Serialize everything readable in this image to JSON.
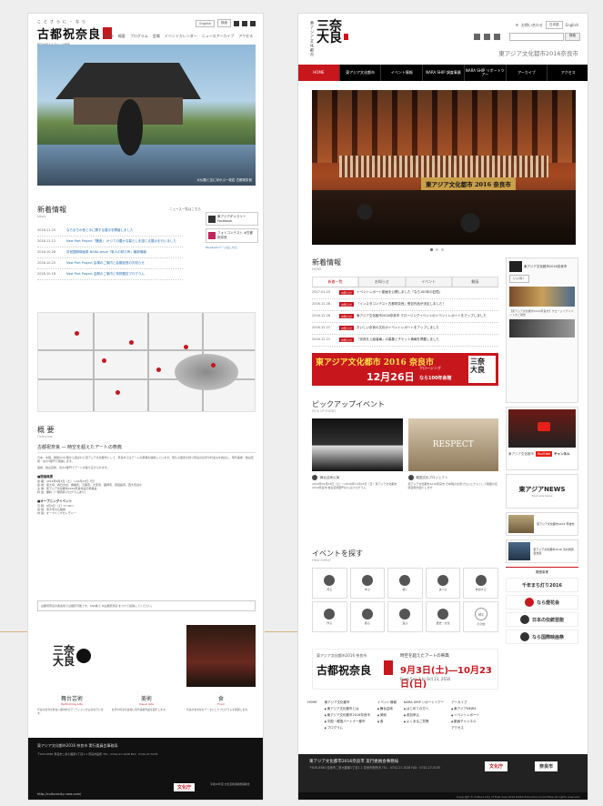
{
  "left_page": {
    "logo": {
      "top": "ことさらに・なら",
      "main": "古都祝奈良",
      "sub": "時空を超えたアートの祭典"
    },
    "util": {
      "btn1": "English",
      "btn2": "検索"
    },
    "nav": [
      "Home",
      "概要",
      "プログラム",
      "会場",
      "イベントカレンダー",
      "ニュースアーカイブ",
      "アクセス"
    ],
    "hero_caption": "大仏殿と空に浮かぶ一枚岩 古都祝奈良",
    "news": {
      "title": "新着情報",
      "sub": "News",
      "more": "ニュース一覧はこちら",
      "items": [
        {
          "date": "2016.11.20",
          "text": "ならまちの昔と今に関する展示を開催しました"
        },
        {
          "date": "2016.11.12",
          "text": "New Port Project「醸造」 かつての豊かな暮らしを感じる展示を行いました"
        },
        {
          "date": "2016.10.28",
          "text": "奈良国際映画祭 NARA-wave「新人の呼び声」最新情報"
        },
        {
          "date": "2016.10.25",
          "text": "New Port Project 会場のご案内と会期延長のお知らせ"
        },
        {
          "date": "2016.10.18",
          "text": "New Port Project 会期のご案内と特別鑑賞プログラム"
        }
      ]
    },
    "side": {
      "fb": "東アジアギャラリー Facebook",
      "ig": "フォトコンテスト #古都祝奈良",
      "link": "Facebookページはこちら"
    },
    "overview": {
      "title": "概 要",
      "sub": "Overview",
      "heading": "古都祝奈良 ― 時空を超えたアートの祭典",
      "para": "日本、中国、韓国の3か国から選ばれた東アジア文化都市として、奈良市ではアートの祭典を開催しています。悠久の歴史を持つ奈良の社寺や町並みを舞台に、現代美術・舞台芸術・食の3部門で展開します。",
      "para2": "美術、舞台芸術、食の3部門でアートが繰り広げられます。",
      "info_head": "■開催概要",
      "info": [
        "会 期：2016年9月3日（土）～10月23日（日）",
        "会 場：東大寺、春日大社、興福寺、元興寺、大安寺、薬師寺、唐招提寺、西大寺ほか",
        "主 催：東アジア文化都市2016奈良市実行委員会",
        "料 金：無料（一部有料プログラムあり）"
      ],
      "open_head": "■オープニングイベント",
      "open": [
        "日 時：9月3日（土）17:00～",
        "会 場：東大寺大仏殿前",
        "内 容：オープニングセレモニー"
      ]
    },
    "note": "古都祝奈良の各会場では撮影可能です。SNS等で #古都祝奈良 をつけて投稿してください。",
    "cards": [
      {
        "cat": "舞台芸術",
        "en": "Performing Arts",
        "desc": "奈良の社寺を舞台に国内外のアーティストが公演を行います。"
      },
      {
        "cat": "美術",
        "en": "Visual Arts",
        "desc": "社寺や町家を会場に現代美術作品を展示します。"
      },
      {
        "cat": "食",
        "en": "Food",
        "desc": "奈良の食文化をテーマにしたプログラムを展開します。"
      }
    ],
    "footer": {
      "title": "東アジア文化都市2016 奈良市 実行委員会事務局",
      "addr": "〒630-8580 奈良市二条大路南1丁目1-1 奈良市役所 TEL：0742-27-1028 FAX：0742-27-5155",
      "url": "http://culturecity-nara.com/",
      "bunka": "文化庁",
      "bunka_text": "平成28年度 文化芸術振興費補助金"
    }
  },
  "right_page": {
    "logo": {
      "vertical": "東アジア文化都市",
      "main": "三奈大良"
    },
    "util": {
      "contact": "お問い合わせ",
      "lang1": "日本語",
      "lang2": "English"
    },
    "search": {
      "placeholder": "",
      "button": "検索"
    },
    "subtitle": "東アジア文化都市2016奈良市",
    "nav": [
      {
        "label": "HOME",
        "active": true
      },
      {
        "label": "東アジア文化都市",
        "active": false
      },
      {
        "label": "イベント情報",
        "active": false
      },
      {
        "label": "NARA SHIP 調査事業",
        "active": false
      },
      {
        "label": "NARA SHIP リポートツアー",
        "active": false
      },
      {
        "label": "アーカイブ",
        "active": false
      },
      {
        "label": "アクセス",
        "active": false
      }
    ],
    "hero_banner": "東アジア文化都市 2016 奈良市",
    "news": {
      "title": "新着情報",
      "sub": "NEWS",
      "tabs": [
        {
          "label": "新着一覧",
          "active": true
        },
        {
          "label": "お知らせ",
          "active": false
        },
        {
          "label": "イベント",
          "active": false
        },
        {
          "label": "動画",
          "active": false
        }
      ],
      "items": [
        {
          "date": "2017.01.20",
          "tag": "お知らせ",
          "text": "イベントレポート動画を公開しました「なら100年の記憶」"
        },
        {
          "date": "2016.12.28",
          "tag": "お知らせ",
          "text": "「インスタコンテスト古都祝奈良」受賞作品が決定しました！"
        },
        {
          "date": "2016.12.26",
          "tag": "お知らせ",
          "text": "東アジア文化都市2016奈良市 クロージングイベントのイベントレポートをアップしました"
        },
        {
          "date": "2016.12.21",
          "tag": "お知らせ",
          "text": "おいしい奈良の文化のイベントレポートをアップしました"
        },
        {
          "date": "2016.12.21",
          "tag": "お知らせ",
          "text": "「奈良を上級者編」の募集とチケット情報を掲載しました"
        }
      ]
    },
    "countdown": {
      "line1": "東アジア文化都市 2016 奈良市",
      "date": "12月26日",
      "closing": "クロージング",
      "sub": "なら100年会館",
      "logo": "三奈大良"
    },
    "pickup": {
      "title": "ピックアップイベント",
      "sub": "PICK UP EVENT",
      "cards": [
        {
          "label": "舞台芸術公演",
          "desc": "2016年09月03日（土）～2016年10月23日（日）東アジア文化都市2016奈良市 舞台芸術部門の公演プログラム"
        },
        {
          "label": "韓国文化プロジェクト",
          "desc": "東アジア文化都市2016奈良市 日中韓の交流プロジェクトとして韓国の伝統芸能を紹介します"
        }
      ],
      "img2_text": "RESPECT"
    },
    "events": {
      "title": "イベントを探す",
      "sub": "FIND EVENT",
      "items": [
        "見る",
        "学ぶ",
        "聴く",
        "食べる",
        "参加する",
        "作る",
        "観る",
        "遊ぶ",
        "歴史・文化",
        "その他"
      ],
      "etc": "etc"
    },
    "festival": {
      "a": "東アジア文化都市2016 奈良市",
      "b": "古都祝奈良",
      "c": "時空を超えたアートの祭典",
      "d": "9月3日(土)―10月23日(日)",
      "e": "From Sep 3 to Oct 23, 2016"
    },
    "sidebar": {
      "fb_name": "東アジア文化都市2016奈良市",
      "fb_like": "いいね！",
      "fb_text": "【東アジア文化都市2016奈良市】クロージングイベントのご報告",
      "yt_label": "YouTube",
      "yt_text": "東アジア文化都市",
      "yt_ch": "チャンネル",
      "anews_title": "東アジアNEWS",
      "anews_sub": "East Asia News",
      "links": [
        {
          "text": "東アジア文化都市2016 寧波市"
        },
        {
          "text": "東アジア文化都市2016 済州特別自治道"
        }
      ],
      "related": "関連事業",
      "related_items": [
        "千年まち灯り2016",
        "なら燈花会",
        "日本の伝統芸能",
        "なら国際映画祭"
      ]
    },
    "footer_nav": [
      {
        "head": "HOME",
        "items": []
      },
      {
        "head": "東アジア文化都市",
        "items": [
          "東アジア文化都市とは",
          "東アジア文化都市2016奈良市",
          "中国・韓国パートナー都市",
          "プログラム"
        ]
      },
      {
        "head": "イベント情報",
        "items": [
          "舞台芸術",
          "美術",
          "食"
        ]
      },
      {
        "head": "NARA SHIP リポートツアー",
        "items": [
          "はじめての方へ",
          "参加申込",
          "よくあるご質問"
        ]
      },
      {
        "head": "アーカイブ",
        "items": [
          "東アジアNEWS",
          "イベントレポート",
          "動画チャンネル"
        ]
      },
      {
        "head": "アクセス",
        "items": []
      }
    ],
    "footer": {
      "title": "東アジア文化都市2016奈良市 実行委員会事務局",
      "addr": "〒630-8580 奈良市二条大路南1丁目1-1 奈良市役所内 TEL：0742-27-1028 FAX：0742-27-5155",
      "bunka": "文化庁",
      "nara": "奈良市",
      "copyright": "Copyright © Culture City of East Asia 2016 NARA Executive Committee All rights reserved."
    }
  }
}
